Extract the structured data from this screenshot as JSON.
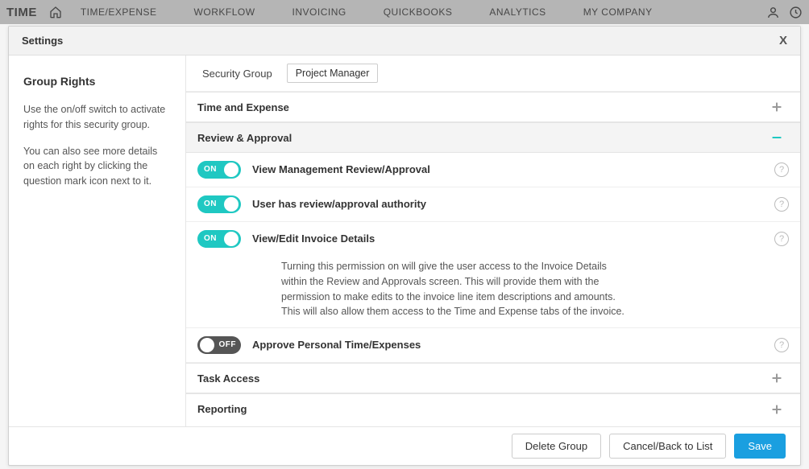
{
  "app": {
    "brand": "TIME",
    "nav": [
      "TIME/EXPENSE",
      "WORKFLOW",
      "INVOICING",
      "QUICKBOOKS",
      "ANALYTICS",
      "MY COMPANY"
    ]
  },
  "modal": {
    "title": "Settings",
    "close_glyph": "X"
  },
  "sidebar": {
    "heading": "Group Rights",
    "para1": "Use the on/off switch to activate rights for this security group.",
    "para2": "You can also see more details on each right by clicking the question mark icon next to it."
  },
  "security_group": {
    "label": "Security Group",
    "value": "Project Manager"
  },
  "toggle_labels": {
    "on": "ON",
    "off": "OFF"
  },
  "help_glyph": "?",
  "sections": {
    "time_expense": {
      "label": "Time and Expense",
      "expanded": false
    },
    "review_approval": {
      "label": "Review & Approval",
      "expanded": true
    },
    "task_access": {
      "label": "Task Access",
      "expanded": false
    },
    "reporting": {
      "label": "Reporting",
      "expanded": false
    }
  },
  "rights": {
    "view_mgmt": {
      "label": "View Management Review/Approval",
      "on": true
    },
    "user_authority": {
      "label": "User has review/approval authority",
      "on": true
    },
    "view_edit_invoice": {
      "label": "View/Edit Invoice Details",
      "on": true,
      "desc": "Turning this permission on will give the user access to the Invoice Details within the Review and Approvals screen. This will provide them with the permission to make edits to the invoice line item descriptions and amounts. This will also allow them access to the Time and Expense tabs of the invoice."
    },
    "approve_personal": {
      "label": "Approve Personal Time/Expenses",
      "on": false
    }
  },
  "footer": {
    "delete": "Delete Group",
    "cancel": "Cancel/Back to List",
    "save": "Save"
  }
}
